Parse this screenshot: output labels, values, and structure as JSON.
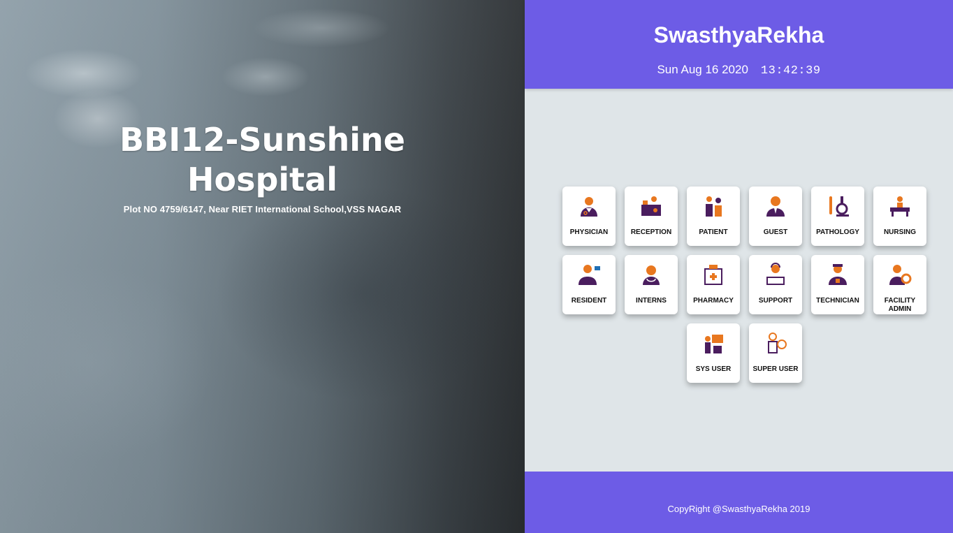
{
  "hero": {
    "hospital_name": "BBI12-Sunshine Hospital",
    "address": "Plot NO 4759/6147, Near RIET International School,VSS NAGAR"
  },
  "header": {
    "brand": "SwasthyaRekha",
    "date": "Sun Aug 16 2020",
    "time": "13:42:39"
  },
  "roles": [
    {
      "label": "PHYSICIAN",
      "icon": "physician-icon"
    },
    {
      "label": "RECEPTION",
      "icon": "reception-icon"
    },
    {
      "label": "PATIENT",
      "icon": "patient-icon"
    },
    {
      "label": "GUEST",
      "icon": "guest-icon"
    },
    {
      "label": "PATHOLOGY",
      "icon": "pathology-icon"
    },
    {
      "label": "NURSING",
      "icon": "nursing-icon"
    },
    {
      "label": "RESIDENT",
      "icon": "resident-icon"
    },
    {
      "label": "INTERNS",
      "icon": "interns-icon"
    },
    {
      "label": "PHARMACY",
      "icon": "pharmacy-icon"
    },
    {
      "label": "SUPPORT",
      "icon": "support-icon"
    },
    {
      "label": "TECHNICIAN",
      "icon": "technician-icon"
    },
    {
      "label": "FACILITY ADMIN",
      "icon": "facility-admin-icon"
    },
    {
      "label": "SYS USER",
      "icon": "sys-user-icon"
    },
    {
      "label": "SUPER USER",
      "icon": "super-user-icon"
    }
  ],
  "colors": {
    "brand": "#6d5ce6",
    "icon_orange": "#e8771f",
    "icon_purple": "#4a1d5e"
  },
  "footer": {
    "copyright": "CopyRight @SwasthyaRekha 2019"
  }
}
